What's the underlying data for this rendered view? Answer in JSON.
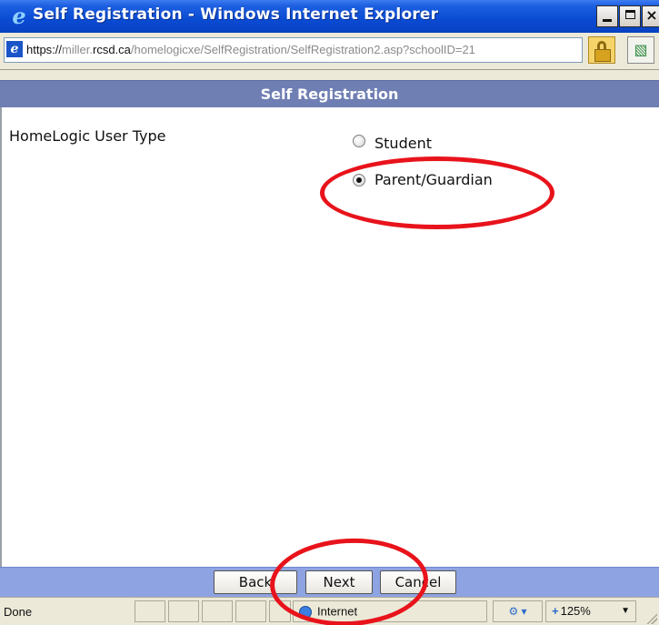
{
  "window": {
    "title": "Self Registration - Windows Internet Explorer"
  },
  "address": {
    "protocol": "https://",
    "host_prefix": "miller.",
    "host_domain": "rcsd.ca",
    "path": "/homelogicxe/SelfRegistration/SelfRegistration2.asp?schoolID=21"
  },
  "page": {
    "header": "Self Registration",
    "field_label": "HomeLogic User Type",
    "options": [
      {
        "label": "Student",
        "selected": false
      },
      {
        "label": "Parent/Guardian",
        "selected": true
      }
    ]
  },
  "buttons": {
    "back": "Back",
    "next": "Next",
    "cancel": "Cancel"
  },
  "status": {
    "text": "Done",
    "zone": "Internet",
    "zoom": "125%"
  },
  "colors": {
    "annotation": "#e8131b",
    "header_bg": "#6f7fb3",
    "footer_bg": "#8ea3e2"
  }
}
